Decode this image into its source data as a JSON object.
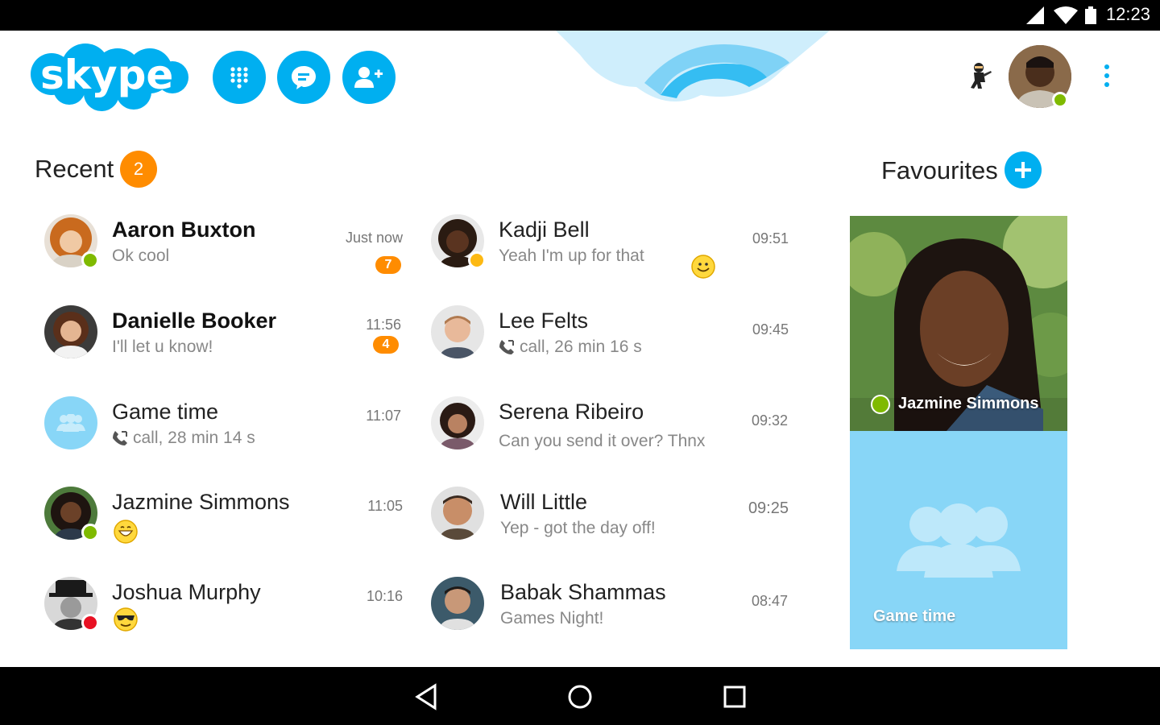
{
  "status_bar": {
    "time": "12:23"
  },
  "header": {
    "logo_text": "skype",
    "colors": {
      "accent": "#00aff0",
      "badge": "#ff8c00",
      "online": "#7fba00",
      "away": "#fdb913",
      "busy": "#e81123"
    },
    "buttons": [
      {
        "icon": "dialpad-icon"
      },
      {
        "icon": "chat-icon"
      },
      {
        "icon": "add-contact-icon"
      }
    ]
  },
  "recent": {
    "title": "Recent",
    "count": "2",
    "left": [
      {
        "name": "Aaron Buxton",
        "message": "Ok cool",
        "time": "Just now",
        "unread": "7",
        "status": "online"
      },
      {
        "name": "Danielle Booker",
        "message": "I'll let u know!",
        "time": "11:56",
        "unread": "4",
        "status": "none"
      },
      {
        "name": "Game time",
        "message": "call, 28 min 14 s",
        "time": "11:07",
        "status": "none"
      },
      {
        "name": "Jazmine Simmons",
        "message": "",
        "time": "11:05",
        "status": "online"
      },
      {
        "name": "Joshua Murphy",
        "message": "",
        "time": "10:16",
        "status": "busy"
      }
    ],
    "right": [
      {
        "name": "Kadji Bell",
        "message": "Yeah I'm up for that",
        "time": "09:51",
        "status": "away"
      },
      {
        "name": "Lee Felts",
        "message": "call, 26 min 16 s",
        "time": "09:45",
        "status": "none"
      },
      {
        "name": "Serena Ribeiro",
        "message": "Can you send it over? Thnx",
        "time": "09:32",
        "status": "none"
      },
      {
        "name": "Will Little",
        "message": "Yep - got the day off!",
        "time": "09:25",
        "status": "none"
      },
      {
        "name": "Babak Shammas",
        "message": "Games Night!",
        "time": "08:47",
        "status": "none"
      }
    ]
  },
  "favourites": {
    "title": "Favourites",
    "cards": [
      {
        "name": "Jazmine Simmons",
        "status": "online"
      },
      {
        "name": "Game time"
      }
    ]
  }
}
